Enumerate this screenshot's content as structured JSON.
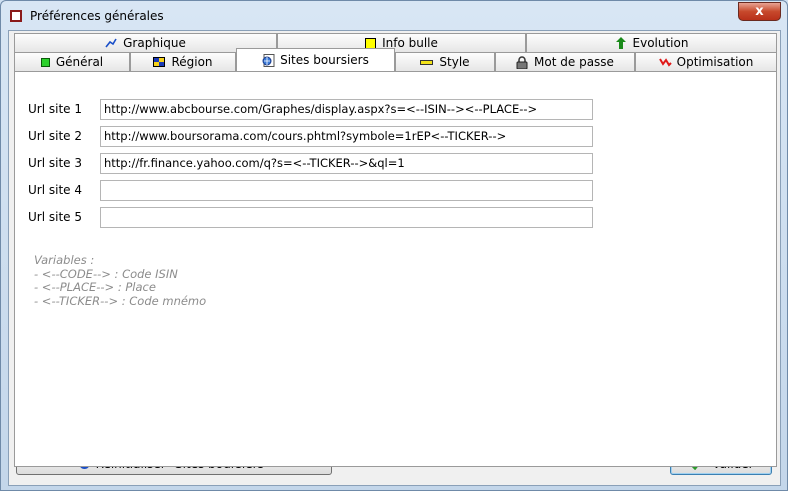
{
  "window": {
    "title": "Préférences générales",
    "close_label": "x"
  },
  "tabs_row1": [
    {
      "label": "Graphique",
      "icon": "line-chart-icon"
    },
    {
      "label": "Info bulle",
      "icon": "yellow-square-icon"
    },
    {
      "label": "Evolution",
      "icon": "green-up-arrow-icon"
    }
  ],
  "tabs_row2": [
    {
      "label": "Général",
      "icon": "green-square-icon"
    },
    {
      "label": "Région",
      "icon": "flag-icon"
    },
    {
      "label": "Sites boursiers",
      "icon": "web-page-icon",
      "active": true
    },
    {
      "label": "Style",
      "icon": "yellow-bar-icon"
    },
    {
      "label": "Mot de passe",
      "icon": "padlock-icon"
    },
    {
      "label": "Optimisation",
      "icon": "red-zigzag-icon"
    }
  ],
  "sites": [
    {
      "label": "Url site 1",
      "value": "http://www.abcbourse.com/Graphes/display.aspx?s=<--ISIN--><--PLACE-->"
    },
    {
      "label": "Url site 2",
      "value": "http://www.boursorama.com/cours.phtml?symbole=1rEP<--TICKER-->"
    },
    {
      "label": "Url site 3",
      "value": "http://fr.finance.yahoo.com/q?s=<--TICKER-->&ql=1"
    },
    {
      "label": "Url site 4",
      "value": ""
    },
    {
      "label": "Url site 5",
      "value": ""
    }
  ],
  "variables": {
    "title": "Variables :",
    "lines": [
      "- <--CODE--> : Code ISIN",
      "- <--PLACE--> : Place",
      "- <--TICKER--> : Code mnémo"
    ]
  },
  "buttons": {
    "reset_label": "Réinitialiser \"Sites boursiers\"",
    "validate_label": "Valider"
  },
  "colors": {
    "accent_blue": "#1a4fc8",
    "check_green": "#2a9a2a",
    "close_red": "#c7492c"
  }
}
